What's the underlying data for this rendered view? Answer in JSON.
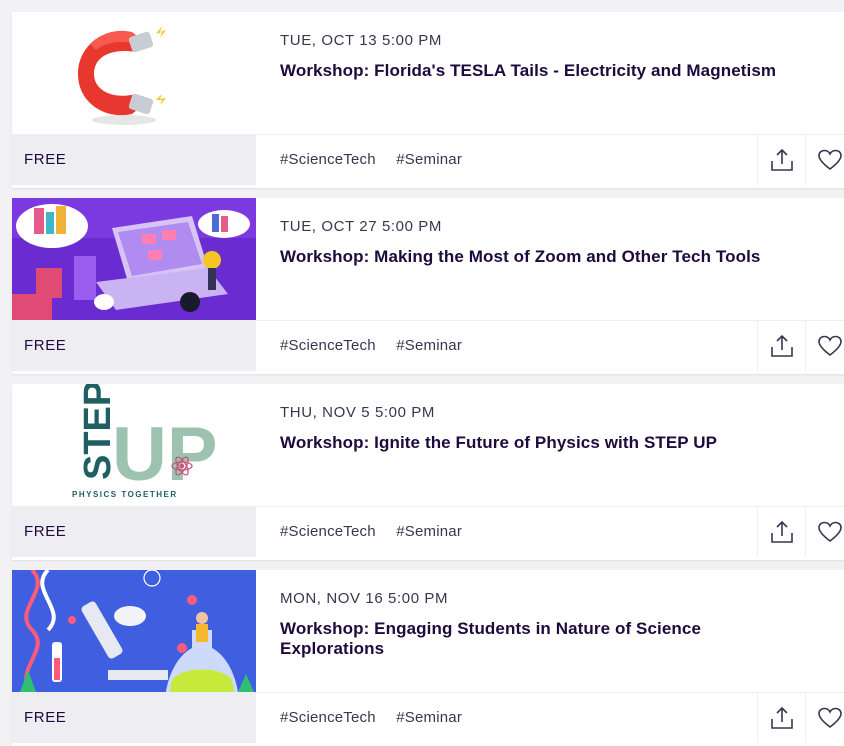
{
  "events": [
    {
      "date": "TUE, OCT 13 5:00 PM",
      "title": "Workshop: Florida's TESLA Tails - Electricity and Magnetism",
      "price": "FREE",
      "tags": [
        "#ScienceTech",
        "#Seminar"
      ],
      "image": "magnet-illustration"
    },
    {
      "date": "TUE, OCT 27 5:00 PM",
      "title": "Workshop: Making the Most of Zoom and Other Tech Tools",
      "price": "FREE",
      "tags": [
        "#ScienceTech",
        "#Seminar"
      ],
      "image": "laptop-workspace-illustration"
    },
    {
      "date": "THU, NOV 5 5:00 PM",
      "title": "Workshop: Ignite the Future of Physics with STEP UP",
      "price": "FREE",
      "tags": [
        "#ScienceTech",
        "#Seminar"
      ],
      "image": "step-up-logo",
      "logo": {
        "word1": "STEP",
        "word2": "UP",
        "tagline": "PHYSICS TOGETHER"
      }
    },
    {
      "date": "MON, NOV 16 5:00 PM",
      "title": "Workshop: Engaging Students in Nature of Science Explorations",
      "price": "FREE",
      "tags": [
        "#ScienceTech",
        "#Seminar"
      ],
      "image": "lab-science-illustration"
    }
  ],
  "icons": {
    "share": "share-icon",
    "like": "heart-icon"
  },
  "colors": {
    "title": "#1e0a3c",
    "meta": "#39364f",
    "price_bg": "#eeedf2",
    "magnet_red": "#e8372f",
    "purple_bg": "#6a2bd1",
    "stepup_teal": "#1f5f63",
    "stepup_sage": "#9ec2b0",
    "lab_blue": "#3f5fe0"
  }
}
